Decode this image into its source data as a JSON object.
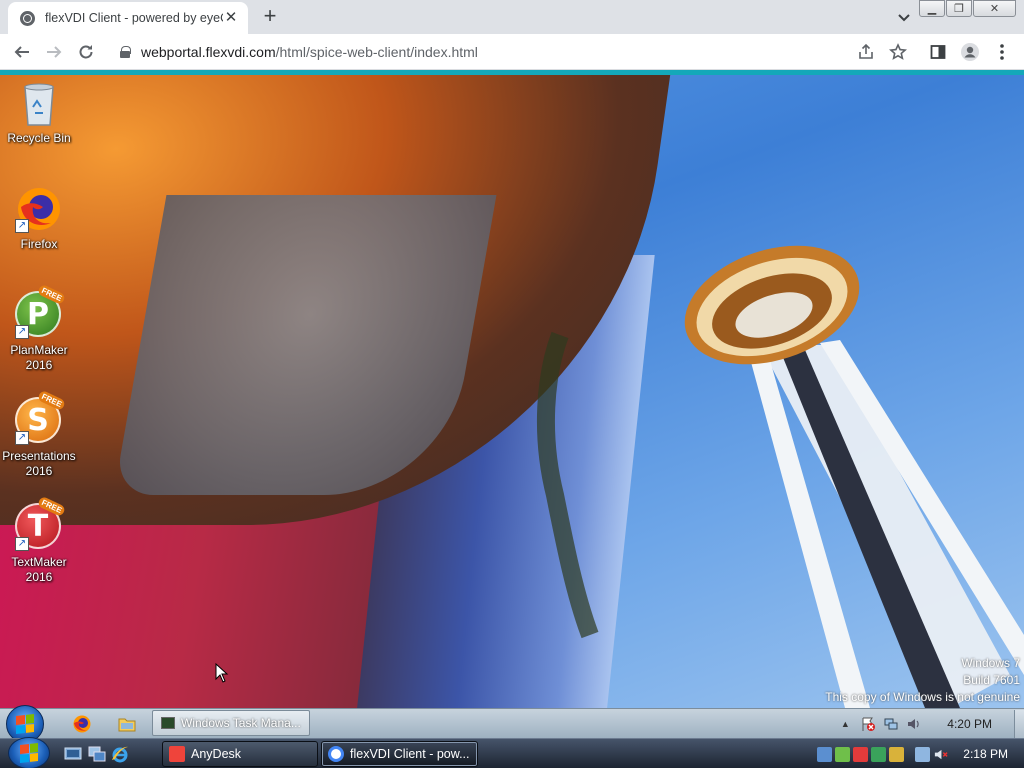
{
  "browser": {
    "tab_title": "flexVDI Client - powered by eyeO",
    "url_host": "webportal.flexvdi.com",
    "url_path": "/html/spice-web-client/index.html",
    "accent_color": "#14a8b9"
  },
  "desktop": {
    "icons": [
      {
        "label": "Recycle Bin",
        "icon": "recycle-bin-icon"
      },
      {
        "label": "Firefox",
        "icon": "firefox-icon"
      },
      {
        "label": "PlanMaker 2016",
        "icon": "planmaker-icon",
        "letter": "P"
      },
      {
        "label": "Presentations 2016",
        "icon": "presentations-icon",
        "letter": "S"
      },
      {
        "label": "TextMaker 2016",
        "icon": "textmaker-icon",
        "letter": "T"
      }
    ],
    "free_badge": "FREE",
    "watermark": {
      "line1": "Windows 7",
      "line2": "Build 7601",
      "line3": "This copy of Windows is not genuine"
    }
  },
  "remote_taskbar": {
    "task_label": "Windows Task Mana...",
    "clock": "4:20 PM"
  },
  "local_taskbar": {
    "tasks": [
      {
        "label": "AnyDesk",
        "color": "#ef443b"
      },
      {
        "label": "flexVDI Client - pow...",
        "color": "#4285f4"
      }
    ],
    "clock": "2:18 PM"
  }
}
